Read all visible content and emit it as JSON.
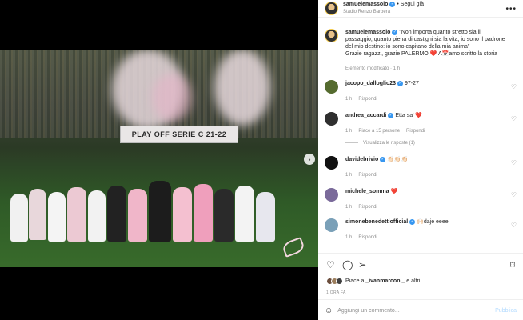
{
  "post": {
    "author": "samuelemassolo",
    "follow_separator": "•",
    "follow_label": "Segui già",
    "location": "Stadio Renzo Barbera",
    "caption": "\"Non importa quanto stretto sia il passaggio, quanto piena di castighi sia la vita, io sono il padrone del mio destino: io sono capitano della mia anima\"",
    "caption_line2": "Grazie ragazzi, grazie PALERMO ❤️ A📅amo scritto la storia",
    "caption_meta": "Elemento modificato · 1 h"
  },
  "photo": {
    "banner_text": "PLAY OFF SERIE C 21-22",
    "carousel_next": "›",
    "dots_count": 4,
    "active_dot": 0
  },
  "comments": [
    {
      "user": "jacopo_dalloglio23",
      "verified": true,
      "text": "97-27",
      "time": "1 h",
      "reply": "Rispondi",
      "likes": ""
    },
    {
      "user": "andrea_accardi",
      "verified": true,
      "text": "Etta sa' ❤️",
      "time": "1 h",
      "likes": "Piace a 15 persone",
      "reply": "Rispondi",
      "view_replies": "Visualizza le risposte (1)"
    },
    {
      "user": "davidebrivio",
      "verified": true,
      "text": "👏🏻👏🏻👏🏻",
      "time": "1 h",
      "reply": "Rispondi",
      "likes": ""
    },
    {
      "user": "michele_somma",
      "verified": false,
      "text": "❤️",
      "time": "1 h",
      "reply": "Rispondi",
      "likes": ""
    },
    {
      "user": "simonebenedettiofficial",
      "verified": true,
      "text": "🙌🏻daje eeee",
      "time": "1 h",
      "reply": "Rispondi",
      "likes": ""
    }
  ],
  "actions": {
    "like_icon": "heart-outline",
    "comment_icon": "comment",
    "share_icon": "send",
    "save_icon": "bookmark"
  },
  "likes": {
    "text_prefix": "Piace a ",
    "user": "_ivanmarconi_",
    "text_suffix": " e altri"
  },
  "time_ago": "1 ORA FA",
  "comment_box": {
    "placeholder": "Aggiungi un commento...",
    "publish_label": "Pubblica"
  },
  "colors": {
    "verified": "#3897f0",
    "publish_disabled": "#b3dbff",
    "heart_red": "#ed4956"
  }
}
